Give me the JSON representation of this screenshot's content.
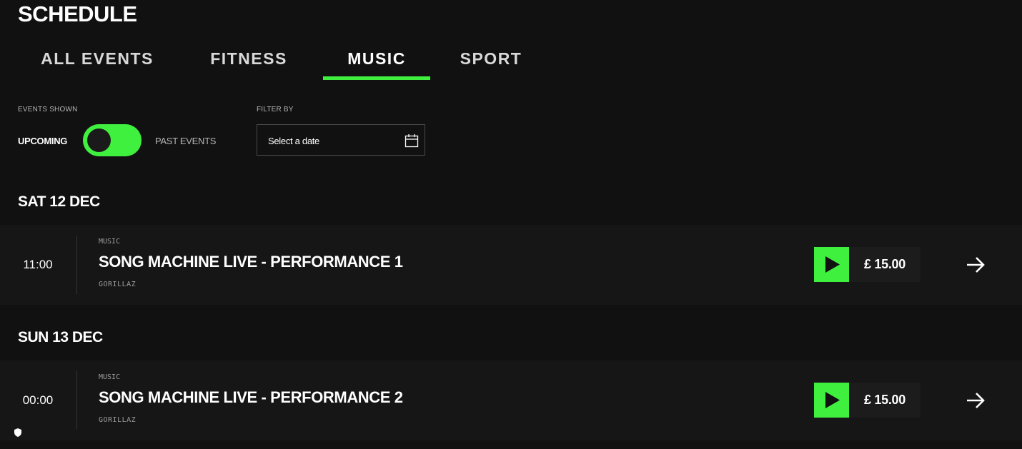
{
  "page": {
    "title": "SCHEDULE"
  },
  "tabs": [
    {
      "label": "ALL EVENTS",
      "active": false
    },
    {
      "label": "FITNESS",
      "active": false
    },
    {
      "label": "MUSIC",
      "active": true
    },
    {
      "label": "SPORT",
      "active": false
    }
  ],
  "filters": {
    "events_shown_label": "EVENTS SHOWN",
    "upcoming_label": "UPCOMING",
    "past_label": "PAST EVENTS",
    "toggle_state": "upcoming",
    "filter_by_label": "FILTER BY",
    "date_placeholder": "Select a date"
  },
  "days": [
    {
      "heading": "SAT 12 DEC",
      "events": [
        {
          "time": "11:00",
          "category": "MUSIC",
          "title": "SONG MACHINE LIVE - PERFORMANCE 1",
          "artist": "GORILLAZ",
          "price": "£ 15.00"
        }
      ]
    },
    {
      "heading": "SUN 13 DEC",
      "events": [
        {
          "time": "00:00",
          "category": "MUSIC",
          "title": "SONG MACHINE LIVE - PERFORMANCE 2",
          "artist": "GORILLAZ",
          "price": "£ 15.00"
        }
      ]
    }
  ],
  "icons": {
    "calendar": "calendar-icon",
    "play": "play-icon",
    "arrow": "arrow-right-icon",
    "privacy": "shield-icon"
  },
  "colors": {
    "accent": "#3ff03f",
    "background": "#111111",
    "row_background": "#161616"
  }
}
